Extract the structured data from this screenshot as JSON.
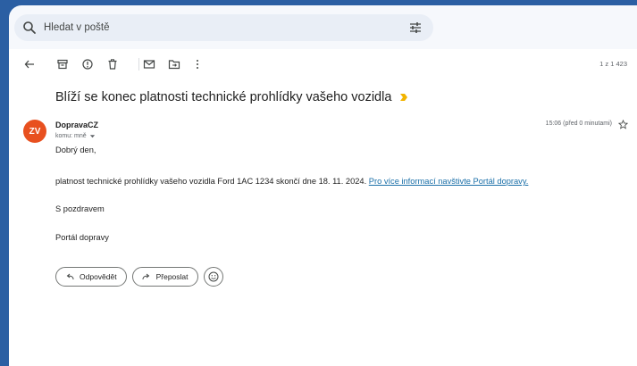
{
  "search": {
    "placeholder": "Hledat v poště"
  },
  "toolbar": {
    "icons": [
      "back-arrow-icon",
      "archive-icon",
      "report-spam-icon",
      "delete-icon",
      "mark-unread-icon",
      "move-to-icon",
      "more-options-icon"
    ],
    "counter": "1 z 1 423"
  },
  "email": {
    "subject": "Blíží se konec platnosti technické prohlídky vašeho vozidla",
    "avatar_initials": "ZV",
    "avatar_color": "#e8501f",
    "sender": "DopravaCZ",
    "recipient": "komu: mně",
    "timestamp": "15:06 (před 0 minutami)",
    "greeting": "Dobrý den,",
    "body_text": "platnost technické prohlídky vašeho vozidla Ford 1AC 1234 skončí dne 18. 11. 2024.",
    "link_text": "Pro více informací navštivte Portál dopravy.",
    "closing": "S pozdravem",
    "signature": "Portál dopravy"
  },
  "actions": {
    "reply_label": "Odpovědět",
    "forward_label": "Přeposlat"
  }
}
